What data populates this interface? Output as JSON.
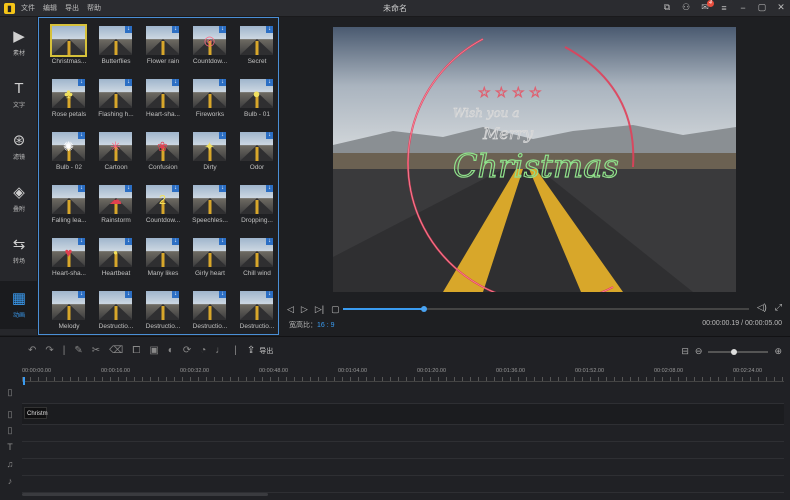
{
  "titlebar": {
    "menu": [
      "文件",
      "编辑",
      "导出",
      "帮助"
    ],
    "title": "未命名",
    "badge": "4"
  },
  "nav": [
    {
      "label": "素材",
      "icon": "media-icon"
    },
    {
      "label": "文字",
      "icon": "text-icon"
    },
    {
      "label": "滤镜",
      "icon": "filter-icon"
    },
    {
      "label": "叠附",
      "icon": "overlay-icon"
    },
    {
      "label": "转场",
      "icon": "transition-icon"
    },
    {
      "label": "动画",
      "icon": "animation-icon"
    }
  ],
  "effects": [
    {
      "name": "Christmas...",
      "fx": "",
      "selected": true,
      "download": false
    },
    {
      "name": "Butterflies",
      "fx": "",
      "download": true
    },
    {
      "name": "Flower rain",
      "fx": "",
      "download": true
    },
    {
      "name": "Countdow...",
      "fx": "◎",
      "download": true
    },
    {
      "name": "Secret",
      "fx": "",
      "download": true
    },
    {
      "name": "Rose petals",
      "fx": "♣",
      "download": true
    },
    {
      "name": "Flashing h...",
      "fx": "",
      "download": true
    },
    {
      "name": "Heart-sha...",
      "fx": "",
      "download": true
    },
    {
      "name": "Fireworks",
      "fx": "",
      "download": true
    },
    {
      "name": "Bulb - 01",
      "fx": "●",
      "download": true
    },
    {
      "name": "Bulb - 02",
      "fx": "✺",
      "download": true
    },
    {
      "name": "Cartoon",
      "fx": "✳",
      "download": false
    },
    {
      "name": "Confusion",
      "fx": "❀",
      "download": false
    },
    {
      "name": "Dirty",
      "fx": "✦",
      "download": true
    },
    {
      "name": "Odor",
      "fx": "",
      "download": true
    },
    {
      "name": "Falling lea...",
      "fx": "",
      "download": true
    },
    {
      "name": "Rainstorm",
      "fx": "☁",
      "download": true
    },
    {
      "name": "Countdow...",
      "fx": "2",
      "download": true
    },
    {
      "name": "Speechles...",
      "fx": "",
      "download": true
    },
    {
      "name": "Dropping...",
      "fx": "",
      "download": true
    },
    {
      "name": "Heart-sha...",
      "fx": "♥",
      "download": true
    },
    {
      "name": "Heartbeat",
      "fx": "•",
      "download": true
    },
    {
      "name": "Many likes",
      "fx": "",
      "download": true
    },
    {
      "name": "Girly heart",
      "fx": "",
      "download": true
    },
    {
      "name": "Chill wind",
      "fx": "",
      "download": true
    },
    {
      "name": "Melody",
      "fx": "",
      "download": true
    },
    {
      "name": "Destructio...",
      "fx": "",
      "download": true
    },
    {
      "name": "Destructio...",
      "fx": "",
      "download": true
    },
    {
      "name": "Destructio...",
      "fx": "",
      "download": true
    },
    {
      "name": "Destructio...",
      "fx": "",
      "download": true
    }
  ],
  "preview": {
    "overlay_text": "Christmas",
    "aspect_label": "宽高比：",
    "aspect_value": "16 : 9",
    "time": "00:00:00.19 / 00:00:05.00",
    "progress": 0.2
  },
  "timeline": {
    "export_label": "导出",
    "ruler": [
      "00:00:00.00",
      "00:00:16.00",
      "00:00:32.00",
      "00:00:48.00",
      "00:01:04.00",
      "00:01:20.00",
      "00:01:36.00",
      "00:01:52.00",
      "00:02:08.00",
      "00:02:24.00"
    ],
    "clip_label": "Christm",
    "zoom_level": 0.42
  },
  "colors": {
    "accent": "#3a9bf0",
    "brand": "#f5c518",
    "selected_border": "#d6c13a"
  }
}
